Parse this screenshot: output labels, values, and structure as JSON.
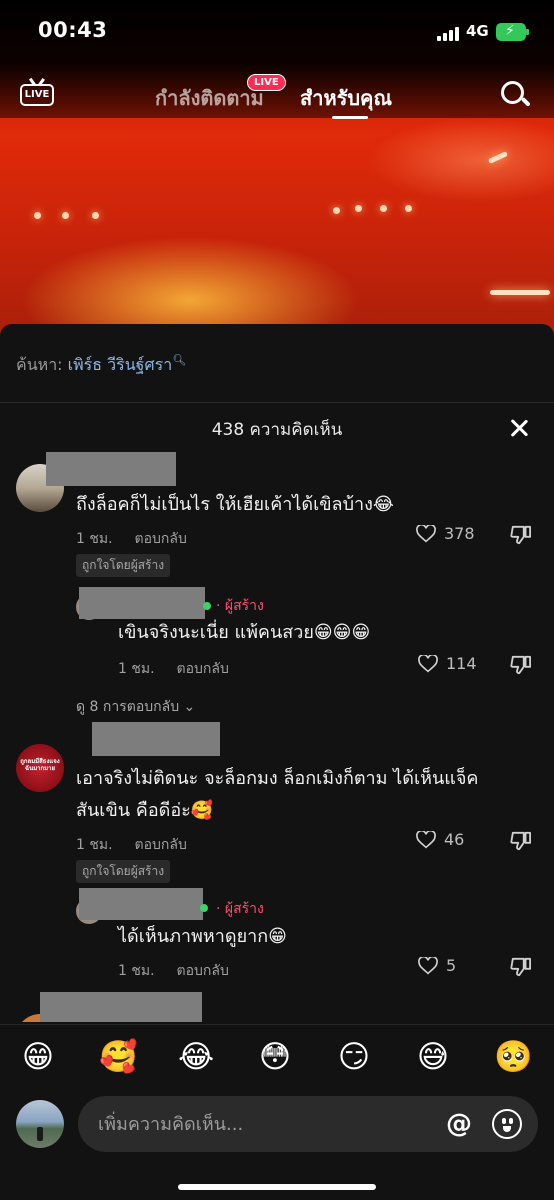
{
  "status_bar": {
    "time": "00:43",
    "network": "4G"
  },
  "top_nav": {
    "live_icon_text": "LIVE",
    "following_label": "กำลังติดตาม",
    "live_badge": "LIVE",
    "for_you_label": "สำหรับคุณ"
  },
  "sheet": {
    "search_prefix": "ค้นหา:",
    "search_term": "เพิร์ธ วีรินฐ์ศรา",
    "comment_count": "438 ความคิดเห็น"
  },
  "comments": [
    {
      "text": "ถึงล็อคก็ไม่เป็นไร ให้เฮียเค้าได้เขิลบ้าง😂",
      "time": "1 ชม.",
      "reply": "ตอบกลับ",
      "likes": "378",
      "liked_by_creator": "ถูกใจโดยผู้สร้าง",
      "replies": [
        {
          "creator_tag": "· ผู้สร้าง",
          "text": "เขินจริงนะเนี่ย แพ้คนสวย😁😁😁",
          "time": "1 ชม.",
          "reply": "ตอบกลับ",
          "likes": "114"
        }
      ],
      "view_replies": "ดู 8 การตอบกลับ"
    },
    {
      "avatar_text": "ถูกลมมีสีธงแจงฉันมากมาย",
      "text_line1": "เอาจริงไม่ติดนะ จะล็อกมง ล็อกเมิงก็ตาม ได้เห็นแจ็ค",
      "text_line2": "สันเขิน คือดีอ่ะ🥰",
      "time": "1 ชม.",
      "reply": "ตอบกลับ",
      "likes": "46",
      "liked_by_creator": "ถูกใจโดยผู้สร้าง",
      "replies": [
        {
          "creator_tag": "· ผู้สร้าง",
          "text": "ได้เห็นภาพหาดูยาก😁",
          "time": "1 ชม.",
          "reply": "ตอบกลับ",
          "likes": "5"
        }
      ]
    }
  ],
  "emoji_bar": [
    "😁",
    "🥰",
    "😂",
    "😳",
    "😏",
    "😅",
    "🥺"
  ],
  "input": {
    "placeholder": "เพิ่มความคิดเห็น...",
    "at_symbol": "@"
  },
  "colors": {
    "creator_red": "#ff4d6d",
    "link_blue": "#8fb5e3",
    "sheet_bg": "#121212"
  }
}
